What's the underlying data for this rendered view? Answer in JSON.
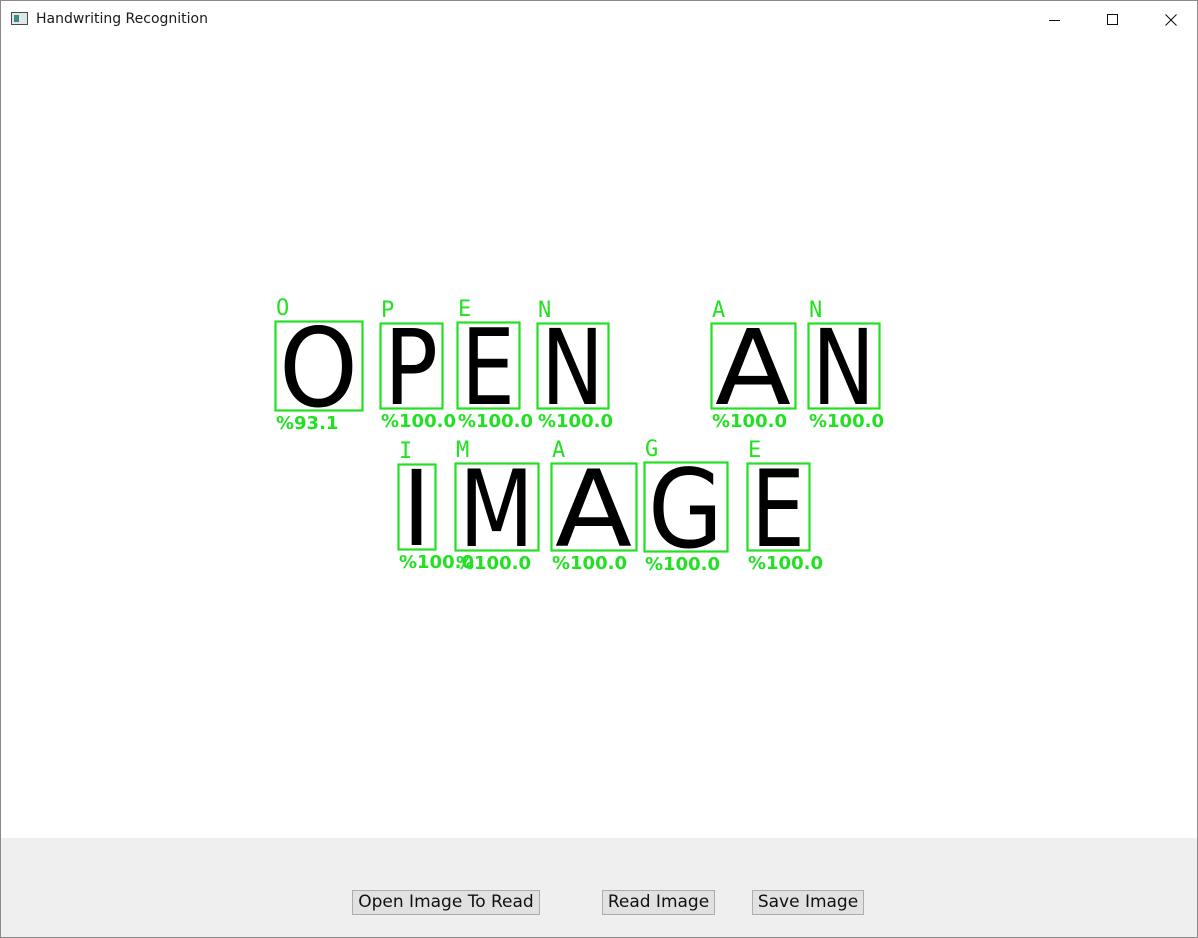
{
  "window": {
    "title": "Handwriting Recognition",
    "app_icon": "window-app-icon",
    "controls": {
      "minimize_icon": "minimize-icon",
      "maximize_icon": "maximize-icon",
      "close_icon": "close-icon"
    }
  },
  "colors": {
    "detection_box": "#22e022",
    "glyph": "#000000",
    "toolbar_bg": "#efefef"
  },
  "recognition": {
    "letters": [
      {
        "label": "O",
        "confidence": "%93.1",
        "glyph": "O"
      },
      {
        "label": "P",
        "confidence": "%100.0",
        "glyph": "P"
      },
      {
        "label": "E",
        "confidence": "%100.0",
        "glyph": "E"
      },
      {
        "label": "N",
        "confidence": "%100.0",
        "glyph": "N"
      },
      {
        "label": "A",
        "confidence": "%100.0",
        "glyph": "A"
      },
      {
        "label": "N",
        "confidence": "%100.0",
        "glyph": "N"
      },
      {
        "label": "I",
        "confidence": "%100.0",
        "glyph": "I"
      },
      {
        "label": "M",
        "confidence": "%100.0",
        "glyph": "M"
      },
      {
        "label": "A",
        "confidence": "%100.0",
        "glyph": "A"
      },
      {
        "label": "G",
        "confidence": "%100.0",
        "glyph": "G"
      },
      {
        "label": "E",
        "confidence": "%100.0",
        "glyph": "E"
      }
    ]
  },
  "toolbar": {
    "open_label": "Open Image To Read",
    "read_label": "Read Image",
    "save_label": "Save Image"
  }
}
